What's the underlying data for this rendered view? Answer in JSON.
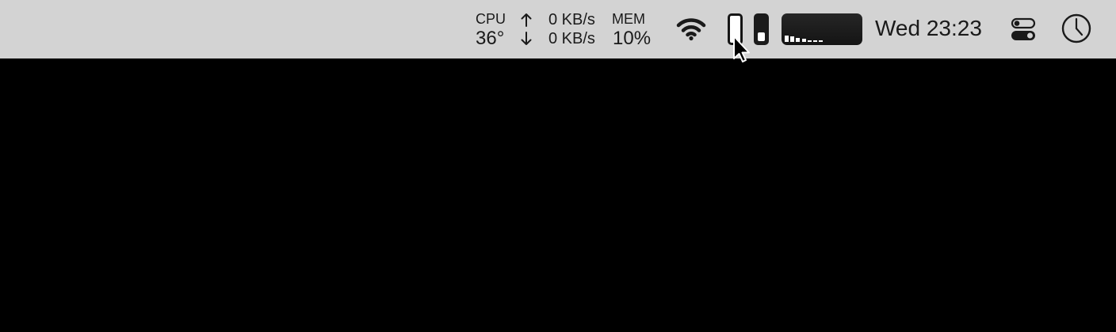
{
  "menubar": {
    "cpu": {
      "label": "CPU",
      "temperature": "36°"
    },
    "network": {
      "upload": "0 KB/s",
      "download": "0 KB/s",
      "upload_icon": "arrow-up-icon",
      "download_icon": "arrow-down-icon"
    },
    "memory": {
      "label": "MEM",
      "value": "10%"
    },
    "wifi_icon": "wifi-icon",
    "gauges": [
      {
        "name": "gauge-1",
        "level": 0.0
      },
      {
        "name": "gauge-2",
        "level": 0.35
      }
    ],
    "activity_graph": {
      "levels": [
        0.2,
        0.18,
        0.13,
        0.09,
        0.06,
        0.06,
        0.06
      ]
    },
    "clock": "Wed 23:23",
    "control_center_icon": "toggles-icon",
    "clock_app_icon": "clock-icon"
  },
  "colors": {
    "menubar_background": "#d3d3d3",
    "desktop_background": "#000000",
    "text": "#1a1a1a"
  }
}
